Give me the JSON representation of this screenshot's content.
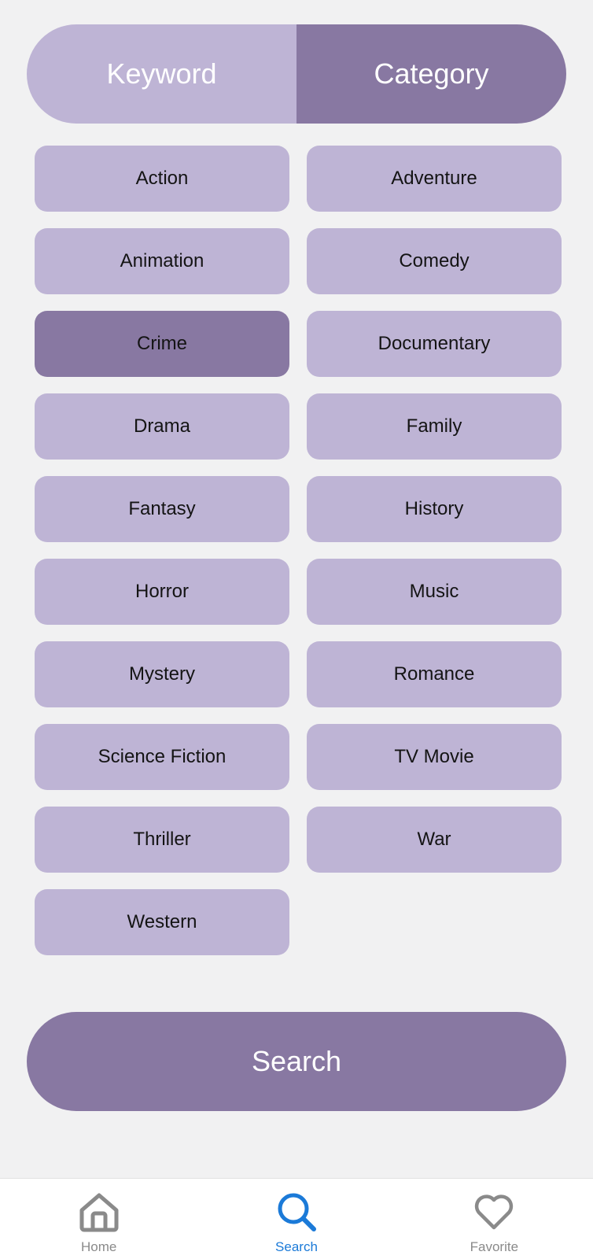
{
  "search_mode": {
    "tabs": [
      {
        "label": "Keyword",
        "active": false
      },
      {
        "label": "Category",
        "active": true
      }
    ]
  },
  "categories": {
    "items": [
      {
        "label": "Action",
        "selected": false
      },
      {
        "label": "Adventure",
        "selected": false
      },
      {
        "label": "Animation",
        "selected": false
      },
      {
        "label": "Comedy",
        "selected": false
      },
      {
        "label": "Crime",
        "selected": true
      },
      {
        "label": "Documentary",
        "selected": false
      },
      {
        "label": "Drama",
        "selected": false
      },
      {
        "label": "Family",
        "selected": false
      },
      {
        "label": "Fantasy",
        "selected": false
      },
      {
        "label": "History",
        "selected": false
      },
      {
        "label": "Horror",
        "selected": false
      },
      {
        "label": "Music",
        "selected": false
      },
      {
        "label": "Mystery",
        "selected": false
      },
      {
        "label": "Romance",
        "selected": false
      },
      {
        "label": "Science Fiction",
        "selected": false
      },
      {
        "label": "TV Movie",
        "selected": false
      },
      {
        "label": "Thriller",
        "selected": false
      },
      {
        "label": "War",
        "selected": false
      },
      {
        "label": "Western",
        "selected": false
      }
    ]
  },
  "search_button": {
    "label": "Search"
  },
  "bottom_nav": {
    "items": [
      {
        "label": "Home",
        "icon": "home-icon",
        "active": false
      },
      {
        "label": "Search",
        "icon": "search-icon",
        "active": true
      },
      {
        "label": "Favorite",
        "icon": "heart-icon",
        "active": false
      }
    ]
  },
  "colors": {
    "chip": "#beb4d5",
    "chip_selected": "#8878a2",
    "background": "#f1f1f2",
    "nav_active": "#1b7ad8",
    "nav_inactive": "#8a8a8a"
  }
}
